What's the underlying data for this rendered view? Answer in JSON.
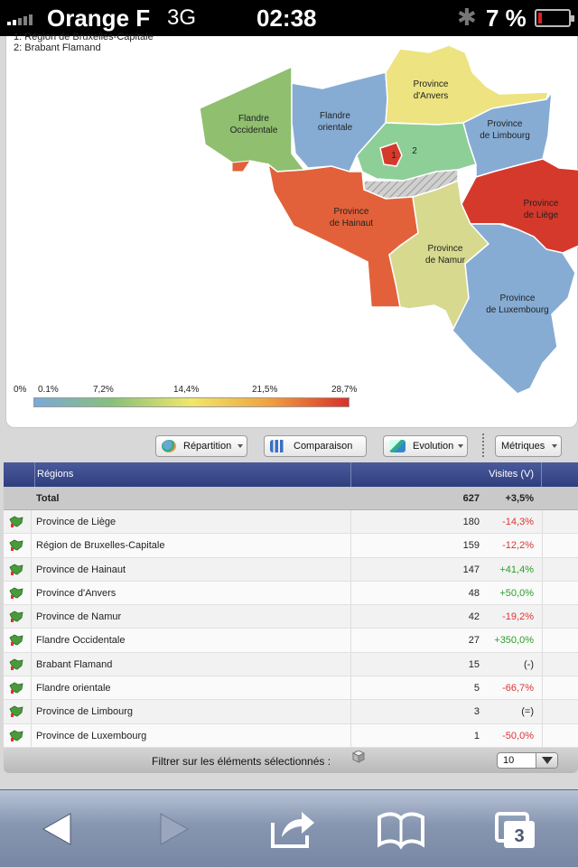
{
  "status": {
    "carrier": "Orange F",
    "network": "3G",
    "time": "02:38",
    "battery": "7 %",
    "battery_level": 0.07
  },
  "map": {
    "legend_lines": [
      "1: Région de Bruxelles-Capitale",
      "2: Brabant Flamand"
    ],
    "regions": [
      {
        "label": [
          "Flandre",
          "Occidentale"
        ],
        "color": "#8fbf6f"
      },
      {
        "label": [
          "Flandre",
          "orientale"
        ],
        "color": "#86acd4"
      },
      {
        "label": [
          "Province",
          "d'Anvers"
        ],
        "color": "#ede380"
      },
      {
        "label": [
          "Province",
          "de Limbourg"
        ],
        "color": "#86acd4"
      },
      {
        "label": [
          "Province",
          "de Liège"
        ],
        "color": "#d5392b"
      },
      {
        "label": [
          "Province",
          "de Hainaut"
        ],
        "color": "#e2613a"
      },
      {
        "label": [
          "Province",
          "de Namur"
        ],
        "color": "#d6d98e"
      },
      {
        "label": [
          "Province",
          "de Luxembourg"
        ],
        "color": "#86acd4"
      }
    ],
    "markers": [
      "1",
      "2"
    ],
    "scale_ticks": [
      "0%",
      "0.1%",
      "7,2%",
      "14,4%",
      "21,5%",
      "28,7%"
    ]
  },
  "toolbar": {
    "repartition": "Répartition",
    "comparaison": "Comparaison",
    "evolution": "Evolution",
    "metriques": "Métriques"
  },
  "table": {
    "col_regions": "Régions",
    "col_visits": "Visites (V)",
    "total": {
      "name": "Total",
      "value": "627",
      "change": "+3,5%"
    },
    "rows": [
      {
        "name": "Province de Liège",
        "value": "180",
        "change": "-14,3%",
        "trend": "red"
      },
      {
        "name": "Région de Bruxelles-Capitale",
        "value": "159",
        "change": "-12,2%",
        "trend": "red"
      },
      {
        "name": "Province de Hainaut",
        "value": "147",
        "change": "+41,4%",
        "trend": "green"
      },
      {
        "name": "Province d'Anvers",
        "value": "48",
        "change": "+50,0%",
        "trend": "green"
      },
      {
        "name": "Province de Namur",
        "value": "42",
        "change": "-19,2%",
        "trend": "red"
      },
      {
        "name": "Flandre Occidentale",
        "value": "27",
        "change": "+350,0%",
        "trend": "green"
      },
      {
        "name": "Brabant Flamand",
        "value": "15",
        "change": "(-)",
        "trend": "neutral"
      },
      {
        "name": "Flandre orientale",
        "value": "5",
        "change": "-66,7%",
        "trend": "red"
      },
      {
        "name": "Province de Limbourg",
        "value": "3",
        "change": "(=)",
        "trend": "neutral"
      },
      {
        "name": "Province de Luxembourg",
        "value": "1",
        "change": "-50,0%",
        "trend": "red"
      }
    ]
  },
  "filter": {
    "label": "Filtrer sur les éléments sélectionnés :",
    "page_size": "10"
  },
  "bottom": {
    "tabs_count": "3"
  }
}
